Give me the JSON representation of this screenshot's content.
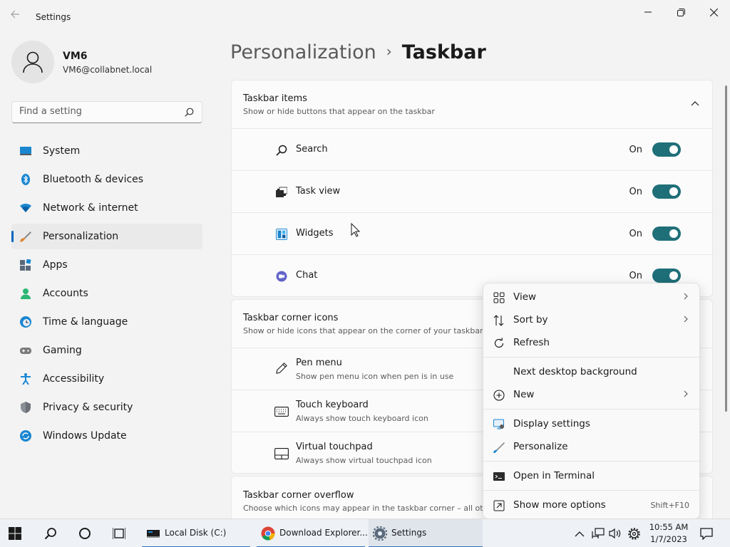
{
  "window": {
    "title": "Settings"
  },
  "user": {
    "name": "VM6",
    "email": "VM6@collabnet.local"
  },
  "search": {
    "placeholder": "Find a setting"
  },
  "sidebar": {
    "items": [
      {
        "label": "System",
        "icon": "system-icon"
      },
      {
        "label": "Bluetooth & devices",
        "icon": "bluetooth-icon"
      },
      {
        "label": "Network & internet",
        "icon": "wifi-icon"
      },
      {
        "label": "Personalization",
        "icon": "brush-icon",
        "active": true
      },
      {
        "label": "Apps",
        "icon": "apps-icon"
      },
      {
        "label": "Accounts",
        "icon": "accounts-icon"
      },
      {
        "label": "Time & language",
        "icon": "clock-globe-icon"
      },
      {
        "label": "Gaming",
        "icon": "gamepad-icon"
      },
      {
        "label": "Accessibility",
        "icon": "accessibility-icon"
      },
      {
        "label": "Privacy & security",
        "icon": "shield-icon"
      },
      {
        "label": "Windows Update",
        "icon": "update-icon"
      }
    ]
  },
  "breadcrumb": {
    "parent": "Personalization",
    "separator": "›",
    "current": "Taskbar"
  },
  "taskbar_items": {
    "title": "Taskbar items",
    "subtitle": "Show or hide buttons that appear on the taskbar",
    "rows": [
      {
        "label": "Search",
        "state": "On",
        "icon": "search-icon"
      },
      {
        "label": "Task view",
        "state": "On",
        "icon": "task-view-icon"
      },
      {
        "label": "Widgets",
        "state": "On",
        "icon": "widgets-icon"
      },
      {
        "label": "Chat",
        "state": "On",
        "icon": "chat-icon"
      }
    ]
  },
  "corner_icons": {
    "title": "Taskbar corner icons",
    "subtitle": "Show or hide icons that appear on the corner of your taskbar",
    "rows": [
      {
        "label": "Pen menu",
        "sub": "Show pen menu icon when pen is in use",
        "icon": "pen-icon"
      },
      {
        "label": "Touch keyboard",
        "sub": "Always show touch keyboard icon",
        "icon": "keyboard-icon"
      },
      {
        "label": "Virtual touchpad",
        "sub": "Always show virtual touchpad icon",
        "icon": "touchpad-icon"
      }
    ]
  },
  "corner_overflow": {
    "title": "Taskbar corner overflow",
    "subtitle": "Choose which icons may appear in the taskbar corner – all oth"
  },
  "context_menu": {
    "view": "View",
    "sort_by": "Sort by",
    "refresh": "Refresh",
    "next_bg": "Next desktop background",
    "new": "New",
    "display_settings": "Display settings",
    "personalize": "Personalize",
    "open_terminal": "Open in Terminal",
    "more_options": "Show more options",
    "more_options_shortcut": "Shift+F10"
  },
  "taskbar": {
    "apps": [
      {
        "label": "Local Disk (C:)"
      },
      {
        "label": "Download Explorer..."
      },
      {
        "label": "Settings"
      }
    ],
    "time": "10:55 AM",
    "date": "1/7/2023"
  },
  "colors": {
    "accent": "#0067c0",
    "toggle_on": "#1f6f78"
  }
}
